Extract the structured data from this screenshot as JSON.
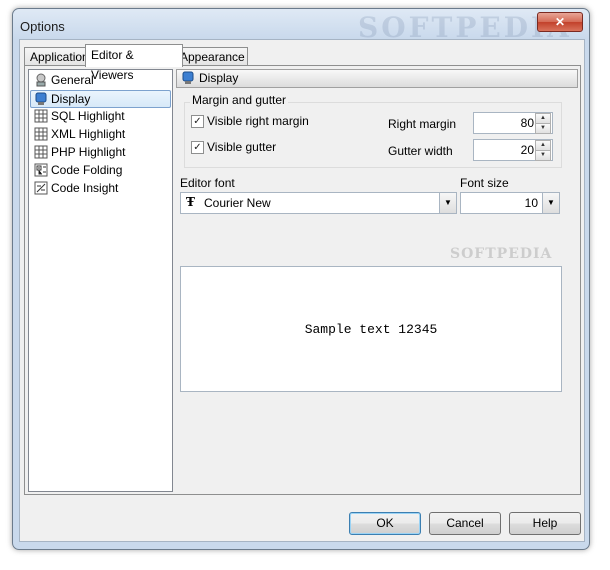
{
  "window": {
    "title": "Options",
    "close_glyph": "✕",
    "watermark": "SOFTPEDIA"
  },
  "tabs": [
    {
      "label": "Application"
    },
    {
      "label": "Editor & Viewers"
    },
    {
      "label": "Appearance"
    }
  ],
  "tree": {
    "items": [
      {
        "label": "General",
        "icon": "general-icon"
      },
      {
        "label": "Display",
        "icon": "display-icon"
      },
      {
        "label": "SQL Highlight",
        "icon": "grid-icon"
      },
      {
        "label": "XML Highlight",
        "icon": "grid-icon"
      },
      {
        "label": "PHP Highlight",
        "icon": "grid-icon"
      },
      {
        "label": "Code Folding",
        "icon": "folding-icon"
      },
      {
        "label": "Code Insight",
        "icon": "insight-icon"
      }
    ],
    "selected": "Display"
  },
  "page": {
    "header": "Display",
    "group_label": "Margin and gutter",
    "visible_right_margin": {
      "label": "Visible right margin",
      "checked": true
    },
    "visible_gutter": {
      "label": "Visible gutter",
      "checked": true
    },
    "right_margin": {
      "label": "Right margin",
      "value": "80"
    },
    "gutter_width": {
      "label": "Gutter width",
      "value": "20"
    },
    "editor_font": {
      "label": "Editor font",
      "value": "Courier New"
    },
    "font_size": {
      "label": "Font size",
      "value": "10"
    },
    "preview_text": "Sample text 12345",
    "watermark2": "SOFTPEDIA"
  },
  "buttons": {
    "ok": "OK",
    "cancel": "Cancel",
    "help": "Help"
  }
}
